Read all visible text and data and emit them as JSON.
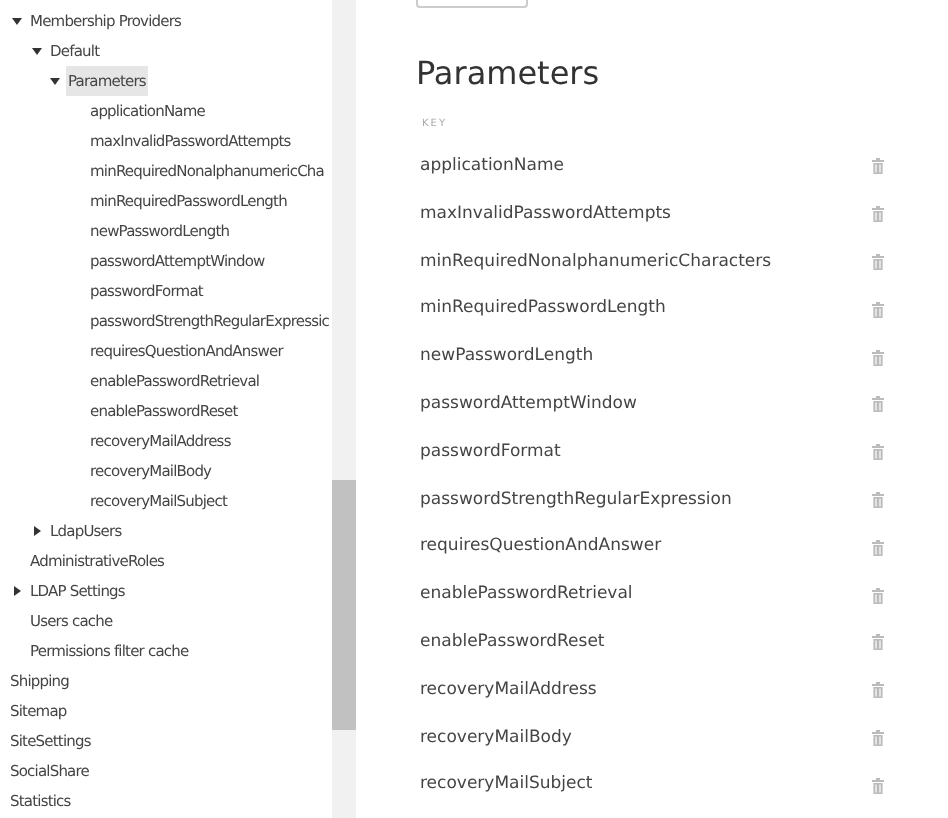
{
  "sidebar": {
    "nested_items": [
      {
        "label": "Membership Providers",
        "expanded": true,
        "selected": false,
        "children": [
          {
            "label": "Default",
            "expanded": true,
            "selected": false,
            "children": [
              {
                "label": "Parameters",
                "expanded": true,
                "selected": true,
                "children": [
                  {
                    "label": "applicationName",
                    "selected": false
                  },
                  {
                    "label": "maxInvalidPasswordAttempts",
                    "selected": false
                  },
                  {
                    "label": "minRequiredNonalphanumericCha",
                    "selected": false
                  },
                  {
                    "label": "minRequiredPasswordLength",
                    "selected": false
                  },
                  {
                    "label": "newPasswordLength",
                    "selected": false
                  },
                  {
                    "label": "passwordAttemptWindow",
                    "selected": false
                  },
                  {
                    "label": "passwordFormat",
                    "selected": false
                  },
                  {
                    "label": "passwordStrengthRegularExpressic",
                    "selected": false
                  },
                  {
                    "label": "requiresQuestionAndAnswer",
                    "selected": false
                  },
                  {
                    "label": "enablePasswordRetrieval",
                    "selected": false
                  },
                  {
                    "label": "enablePasswordReset",
                    "selected": false
                  },
                  {
                    "label": "recoveryMailAddress",
                    "selected": false
                  },
                  {
                    "label": "recoveryMailBody",
                    "selected": false
                  },
                  {
                    "label": "recoveryMailSubject",
                    "selected": false
                  }
                ]
              }
            ]
          },
          {
            "label": "LdapUsers",
            "expanded": false,
            "selected": false
          }
        ]
      },
      {
        "label": "AdministrativeRoles",
        "selected": false
      },
      {
        "label": "LDAP Settings",
        "expanded": false,
        "selected": false
      },
      {
        "label": "Users cache",
        "selected": false
      },
      {
        "label": "Permissions filter cache",
        "selected": false
      }
    ],
    "items": [
      {
        "label": "Shipping",
        "selected": false
      },
      {
        "label": "Sitemap",
        "selected": false
      },
      {
        "label": "SiteSettings",
        "selected": false
      },
      {
        "label": "SocialShare",
        "selected": false
      },
      {
        "label": "Statistics",
        "selected": false
      }
    ]
  },
  "main": {
    "title": "Parameters",
    "table": {
      "columns": [
        "KEY"
      ],
      "rows": [
        "applicationName",
        "maxInvalidPasswordAttempts",
        "minRequiredNonalphanumericCharacters",
        "minRequiredPasswordLength",
        "newPasswordLength",
        "passwordAttemptWindow",
        "passwordFormat",
        "passwordStrengthRegularExpression",
        "requiresQuestionAndAnswer",
        "enablePasswordRetrieval",
        "enablePasswordReset",
        "recoveryMailAddress",
        "recoveryMailBody",
        "recoveryMailSubject"
      ]
    }
  }
}
